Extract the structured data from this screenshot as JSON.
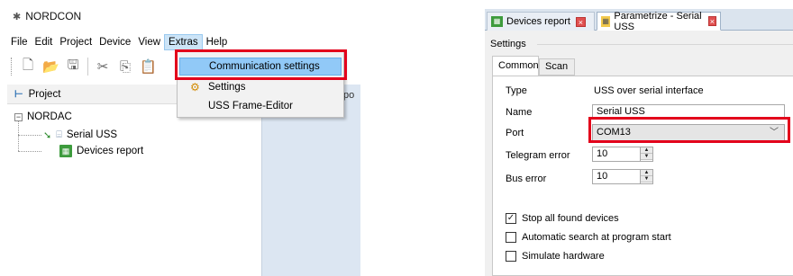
{
  "left_window": {
    "app_title": "NORDCON",
    "menu": [
      "File",
      "Edit",
      "Project",
      "Device",
      "View",
      "Extras",
      "Help"
    ],
    "active_menu": "Extras",
    "dropdown_items": [
      "Communication settings",
      "Settings",
      "USS Frame-Editor"
    ],
    "highlighted_item": "Communication settings",
    "panel_title": "Project",
    "panel_header_partial": "po",
    "tree": {
      "root": "NORDAC",
      "children": [
        "Serial USS",
        "Devices report"
      ]
    }
  },
  "right_window": {
    "doc_tabs": [
      "Devices report",
      "Parametrize - Serial USS"
    ],
    "active_doc_tab": "Parametrize - Serial USS",
    "group_label": "Settings",
    "inner_tabs": [
      "Common",
      "Scan"
    ],
    "active_inner_tab": "Common",
    "fields": {
      "type_label": "Type",
      "type_value": "USS over serial interface",
      "name_label": "Name",
      "name_value": "Serial USS",
      "port_label": "Port",
      "port_value": "COM13",
      "telegram_error_label": "Telegram error",
      "telegram_error_value": "10",
      "bus_error_label": "Bus error",
      "bus_error_value": "10"
    },
    "checkboxes": [
      {
        "label": "Stop all found devices",
        "checked": true
      },
      {
        "label": "Automatic search at program start",
        "checked": false
      },
      {
        "label": "Simulate hardware",
        "checked": false
      }
    ]
  },
  "highlight_color": "#e3001b"
}
